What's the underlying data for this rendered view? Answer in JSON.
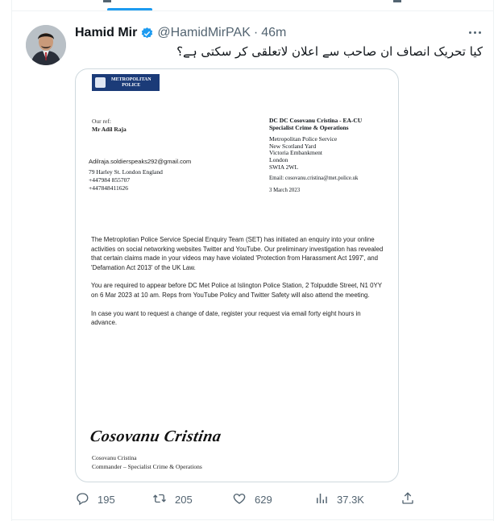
{
  "colors": {
    "accent": "#1d9bf0",
    "text": "#0f1419",
    "muted": "#536471",
    "police_blue": "#1b3b78"
  },
  "tweet": {
    "author_name": "Hamid Mir",
    "handle": "@HamidMirPAK",
    "separator": "·",
    "time": "46m",
    "text": "کیا تحریک انصاف ان صاحب سے اعلان لاتعلقی کر سکتی ہے؟",
    "verified_icon": "verified-badge-icon",
    "more_icon": "more-options-icon"
  },
  "letter": {
    "logo_line1": "METROPOLITAN",
    "logo_line2": "POLICE",
    "our_ref_label": "Our ref:",
    "our_ref_value": "Mr Adil Raja",
    "email": "Adilraja.soldierspeaks292@gmail.com",
    "address": "79 Harley St. London England",
    "phone1": "+447984 855707",
    "phone2": "+447848411626",
    "sender_line1": "DC DC Cosovanu Cristina - EA-CU",
    "sender_line2": "Specialist Crime & Operations",
    "org": "Metropolitan Police Service",
    "addr1": "New Scotland Yard",
    "addr2": "Victoria Embankment",
    "addr3": "London",
    "addr4": "SWIA 2WL",
    "sender_email": "Email: cosovanu.cristina@met.police.uk",
    "date": "3 March 2023",
    "para1": "The Metroplotian Police Service Special Enquiry Team (SET) has initiated an enquiry into your online activities on social networking websites Twitter and YouTube. Our preliminary investigation has revealed that certain claims made in your videos may have violated 'Protection from Harassment Act 1997', and 'Defamation Act 2013' of the UK Law.",
    "para2": "You are required to appear before DC Met Police at Islington Police Station, 2 Tolpuddle Street, N1 0YY on 6 Mar 2023 at 10 am. Reps from YouTube Policy and Twitter Safety will also attend the meeting.",
    "para3": "In case you want to request a change of date, register your request via email forty eight hours in advance.",
    "signature": "Cosovanu Cristina",
    "signer_name": "Cosovanu Cristina",
    "signer_title": "Commander – Specialist Crime & Operations"
  },
  "actions": {
    "replies": "195",
    "retweets": "205",
    "likes": "629",
    "views": "37.3K",
    "icons": [
      "reply-icon",
      "retweet-icon",
      "like-icon",
      "views-icon",
      "share-icon"
    ]
  }
}
